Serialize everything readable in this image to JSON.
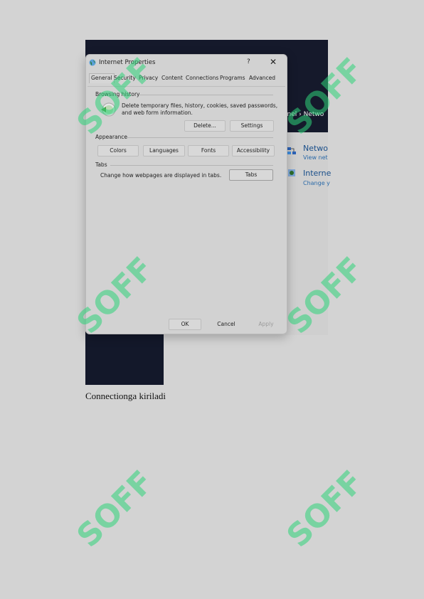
{
  "dialog": {
    "title": "Internet Properties",
    "help": "?",
    "close": "✕",
    "tabs": [
      "General",
      "Security",
      "Privacy",
      "Content",
      "Connections",
      "Programs",
      "Advanced"
    ],
    "browsing_history": {
      "heading": "Browsing history",
      "text_line1": "Delete temporary files, history, cookies, saved passwords,",
      "text_line2": "and web form information.",
      "delete_label": "Delete...",
      "settings_label": "Settings"
    },
    "appearance": {
      "heading": "Appearance",
      "buttons": [
        "Colors",
        "Languages",
        "Fonts",
        "Accessibility"
      ]
    },
    "tabs_section": {
      "heading": "Tabs",
      "text": "Change how webpages are displayed in tabs.",
      "button": "Tabs"
    },
    "footer": {
      "ok": "OK",
      "cancel": "Cancel",
      "apply": "Apply"
    }
  },
  "background": {
    "breadcrumb": "anel  ›  Netwo",
    "items": [
      {
        "title": "Netwo",
        "subtitle": "View net"
      },
      {
        "title": "Interne",
        "subtitle": "Change y"
      }
    ]
  },
  "caption": "Connectionga kiriladi",
  "watermark_text": "SOFF",
  "colors": {
    "watermark": "#2fd37a",
    "dark_bg": "#15192b"
  }
}
